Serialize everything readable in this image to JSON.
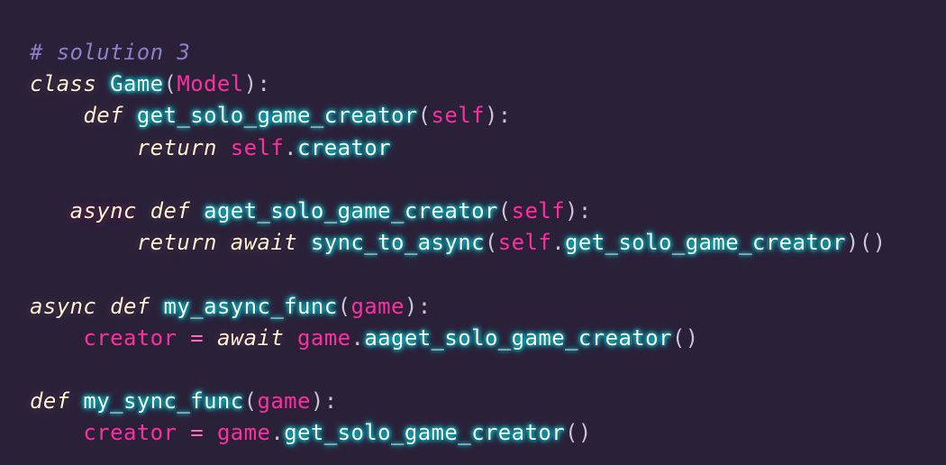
{
  "lines": [
    [
      {
        "t": "# solution 3",
        "c": "comment"
      }
    ],
    [
      {
        "t": "class",
        "c": "keyword"
      },
      {
        "t": " ",
        "c": "plain"
      },
      {
        "t": "Game",
        "c": "name"
      },
      {
        "t": "(",
        "c": "punct"
      },
      {
        "t": "Model",
        "c": "param"
      },
      {
        "t": "):",
        "c": "punct"
      }
    ],
    [
      {
        "t": "    ",
        "c": "plain"
      },
      {
        "t": "def",
        "c": "keyword"
      },
      {
        "t": " ",
        "c": "plain"
      },
      {
        "t": "get_solo_game_creator",
        "c": "func"
      },
      {
        "t": "(",
        "c": "punct"
      },
      {
        "t": "self",
        "c": "self"
      },
      {
        "t": "):",
        "c": "punct"
      }
    ],
    [
      {
        "t": "        ",
        "c": "plain"
      },
      {
        "t": "return",
        "c": "keyword"
      },
      {
        "t": " ",
        "c": "plain"
      },
      {
        "t": "self",
        "c": "self"
      },
      {
        "t": ".",
        "c": "punct"
      },
      {
        "t": "creator",
        "c": "func"
      }
    ],
    [
      {
        "t": "",
        "c": "plain"
      }
    ],
    [
      {
        "t": "   ",
        "c": "plain"
      },
      {
        "t": "async",
        "c": "kw-async"
      },
      {
        "t": " ",
        "c": "plain"
      },
      {
        "t": "def",
        "c": "keyword"
      },
      {
        "t": " ",
        "c": "plain"
      },
      {
        "t": "aget_solo_game_creator",
        "c": "func"
      },
      {
        "t": "(",
        "c": "punct"
      },
      {
        "t": "self",
        "c": "self"
      },
      {
        "t": "):",
        "c": "punct"
      }
    ],
    [
      {
        "t": "        ",
        "c": "plain"
      },
      {
        "t": "return",
        "c": "keyword"
      },
      {
        "t": " ",
        "c": "plain"
      },
      {
        "t": "await",
        "c": "keyword"
      },
      {
        "t": " ",
        "c": "plain"
      },
      {
        "t": "sync_to_async",
        "c": "func"
      },
      {
        "t": "(",
        "c": "punct"
      },
      {
        "t": "self",
        "c": "self"
      },
      {
        "t": ".",
        "c": "punct"
      },
      {
        "t": "get_solo_game_creator",
        "c": "func"
      },
      {
        "t": ")()",
        "c": "punct"
      }
    ],
    [
      {
        "t": "",
        "c": "plain"
      }
    ],
    [
      {
        "t": "async",
        "c": "keyword"
      },
      {
        "t": " ",
        "c": "plain"
      },
      {
        "t": "def",
        "c": "keyword"
      },
      {
        "t": " ",
        "c": "plain"
      },
      {
        "t": "my_async_func",
        "c": "func"
      },
      {
        "t": "(",
        "c": "punct"
      },
      {
        "t": "game",
        "c": "param"
      },
      {
        "t": "):",
        "c": "punct"
      }
    ],
    [
      {
        "t": "    ",
        "c": "plain"
      },
      {
        "t": "creator",
        "c": "param"
      },
      {
        "t": " ",
        "c": "plain"
      },
      {
        "t": "=",
        "c": "op"
      },
      {
        "t": " ",
        "c": "plain"
      },
      {
        "t": "await",
        "c": "keyword"
      },
      {
        "t": " ",
        "c": "plain"
      },
      {
        "t": "game",
        "c": "param"
      },
      {
        "t": ".",
        "c": "punct"
      },
      {
        "t": "aaget_solo_game_creator",
        "c": "func"
      },
      {
        "t": "()",
        "c": "punct"
      }
    ],
    [
      {
        "t": "",
        "c": "plain"
      }
    ],
    [
      {
        "t": "def",
        "c": "keyword"
      },
      {
        "t": " ",
        "c": "plain"
      },
      {
        "t": "my_sync_func",
        "c": "func"
      },
      {
        "t": "(",
        "c": "punct"
      },
      {
        "t": "game",
        "c": "param"
      },
      {
        "t": "):",
        "c": "punct"
      }
    ],
    [
      {
        "t": "    ",
        "c": "plain"
      },
      {
        "t": "creator",
        "c": "param"
      },
      {
        "t": " ",
        "c": "plain"
      },
      {
        "t": "=",
        "c": "op"
      },
      {
        "t": " ",
        "c": "plain"
      },
      {
        "t": "game",
        "c": "param"
      },
      {
        "t": ".",
        "c": "punct"
      },
      {
        "t": "get_solo_game_creator",
        "c": "func"
      },
      {
        "t": "()",
        "c": "punct"
      }
    ]
  ],
  "colors": {
    "background": "#2a2139",
    "comment": "#8a80c9",
    "keyword": "#fff5d6",
    "name_glow": "#03edf9",
    "param": "#ff2ea0",
    "operator": "#ff6ac1"
  }
}
